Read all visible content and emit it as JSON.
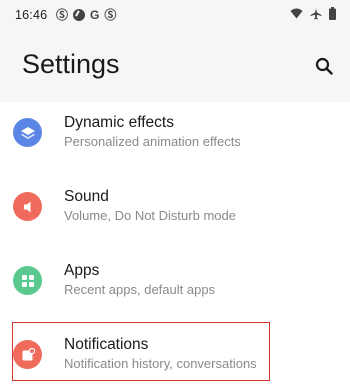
{
  "status_bar": {
    "time": "16:46",
    "left_icons": [
      "s-notification-icon",
      "compass-icon",
      "google-icon",
      "s-notification-icon"
    ],
    "right_icons": [
      "wifi-icon",
      "airplane-icon",
      "battery-icon"
    ]
  },
  "header": {
    "title": "Settings",
    "search_icon": "search-icon"
  },
  "items": [
    {
      "title": "Dynamic effects",
      "subtitle": "Personalized animation effects",
      "icon": "layers-icon",
      "icon_color": "#5b86e5"
    },
    {
      "title": "Sound",
      "subtitle": "Volume, Do Not Disturb mode",
      "icon": "speaker-icon",
      "icon_color": "#f06b5b"
    },
    {
      "title": "Apps",
      "subtitle": "Recent apps, default apps",
      "icon": "apps-grid-icon",
      "icon_color": "#5ac98f"
    },
    {
      "title": "Notifications",
      "subtitle": "Notification history, conversations",
      "icon": "notification-badge-icon",
      "icon_color": "#f06b5b"
    }
  ],
  "highlight": {
    "target": "Notifications",
    "color": "#d9342b"
  }
}
